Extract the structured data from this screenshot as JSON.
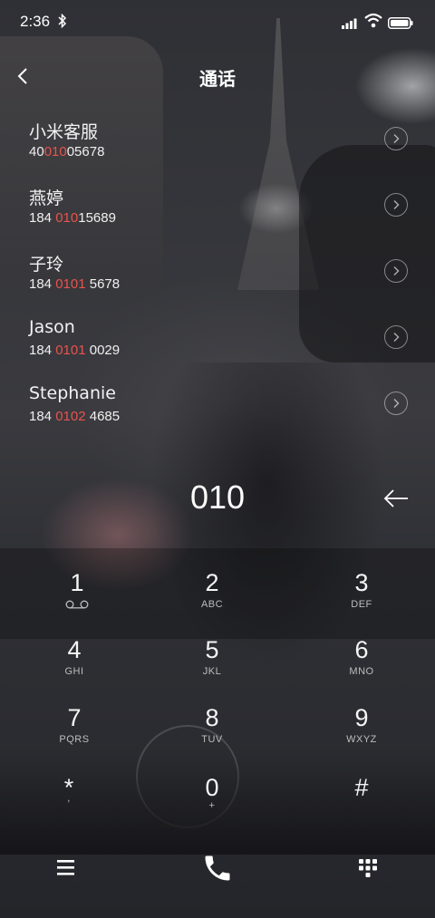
{
  "status_bar": {
    "time": "2:36"
  },
  "header": {
    "title": "通话"
  },
  "contacts": [
    {
      "name": "小米客服",
      "number_pre": "40",
      "number_match": "010",
      "number_post": "05678"
    },
    {
      "name": "燕婷",
      "number_pre": "184 ",
      "number_match": "010",
      "number_post": "15689"
    },
    {
      "name": "子玲",
      "number_pre": "184 ",
      "number_match": "0101",
      "number_post": " 5678"
    },
    {
      "name": "Jason",
      "number_pre": "184 ",
      "number_match": "0101",
      "number_post": " 0029"
    },
    {
      "name": "Stephanie",
      "number_pre": "184 ",
      "number_match": "0102",
      "number_post": " 4685"
    }
  ],
  "dial": {
    "digits": "010"
  },
  "keypad": {
    "keys": [
      {
        "digit": "1",
        "letters": ""
      },
      {
        "digit": "2",
        "letters": "ABC"
      },
      {
        "digit": "3",
        "letters": "DEF"
      },
      {
        "digit": "4",
        "letters": "GHI"
      },
      {
        "digit": "5",
        "letters": "JKL"
      },
      {
        "digit": "6",
        "letters": "MNO"
      },
      {
        "digit": "7",
        "letters": "PQRS"
      },
      {
        "digit": "8",
        "letters": "TUV"
      },
      {
        "digit": "9",
        "letters": "WXYZ"
      },
      {
        "digit": "*",
        "letters": ","
      },
      {
        "digit": "0",
        "letters": "+"
      },
      {
        "digit": "#",
        "letters": ""
      }
    ]
  },
  "colors": {
    "match_highlight": "#e8534e",
    "text": "#ffffff"
  },
  "icons": {
    "back": "chevron-left-icon",
    "contact_detail": "chevron-right-circle-icon",
    "backspace": "arrow-left-icon",
    "voicemail": "voicemail-icon",
    "menu": "hamburger-menu-icon",
    "call": "phone-icon",
    "dialpad": "dialpad-grid-icon"
  }
}
